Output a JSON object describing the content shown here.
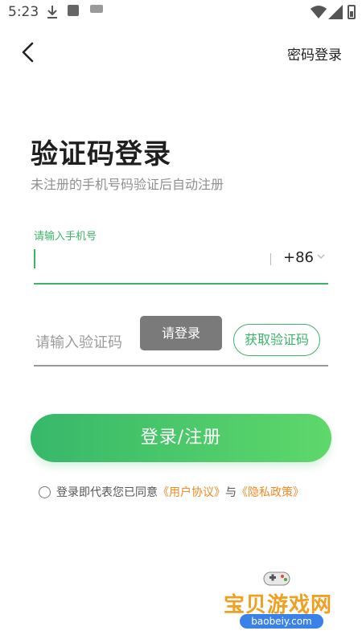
{
  "status_bar": {
    "time": "5:23"
  },
  "header": {
    "password_login_label": "密码登录"
  },
  "main": {
    "title": "验证码登录",
    "subtitle": "未注册的手机号码验证后自动注册",
    "phone": {
      "label": "请输入手机号",
      "value": "",
      "country_code": "+86"
    },
    "code": {
      "placeholder": "请输入验证码",
      "get_code_label": "获取验证码"
    },
    "toast": "请登录",
    "login_button_label": "登录/注册",
    "agreement": {
      "prefix": "登录即代表您已同意",
      "user_agreement": "《用户协议》",
      "joiner": "与",
      "privacy_policy": "《隐私政策》"
    }
  },
  "watermark": {
    "name": "宝贝游戏网",
    "url": "baobeiy.com"
  },
  "colors": {
    "accent": "#3cb568",
    "link": "#f08a24"
  }
}
